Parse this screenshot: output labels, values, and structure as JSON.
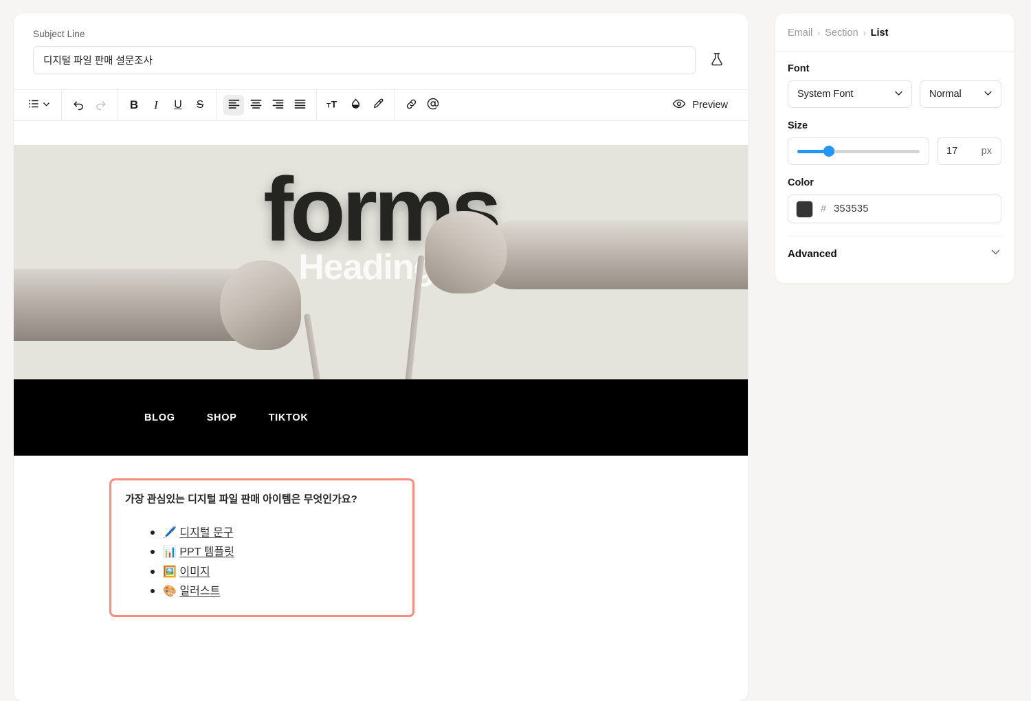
{
  "editor": {
    "subject": {
      "label": "Subject Line",
      "value": "디지털 파일 판매 설문조사",
      "placeholder": "Subject Line",
      "ab_test_icon": "flask-icon"
    },
    "toolbar": {
      "list_icon": "bullet-list-icon",
      "list_chevron_icon": "chevron-down-icon",
      "undo_icon": "undo-icon",
      "redo_icon": "redo-icon",
      "bold_label": "B",
      "italic_label": "I",
      "underline_label": "U",
      "strikethrough_label": "S",
      "align_left_icon": "align-left-icon",
      "align_center_icon": "align-center-icon",
      "align_right_icon": "align-right-icon",
      "align_justify_icon": "align-justify-icon",
      "font_size_label": "TT",
      "text_color_icon": "droplet-icon",
      "highlighter_icon": "highlighter-icon",
      "link_icon": "link-icon",
      "mention_icon": "at-icon",
      "preview_label": "Preview",
      "preview_icon": "eye-icon",
      "active_alignment": "left"
    }
  },
  "email": {
    "hero": {
      "brand_text": "forms",
      "heading_text": "Heading 1",
      "background_color": "#e4e3dc"
    },
    "navbar": {
      "background_color": "#000000",
      "links": [
        {
          "label": "BLOG"
        },
        {
          "label": "SHOP"
        },
        {
          "label": "TIKTOK"
        }
      ]
    },
    "selected_block": {
      "outline_color": "#fb8c7e",
      "question": "가장 관심있는 디지털 파일 판매 아이템은 무엇인가요?",
      "items": [
        {
          "emoji": "🖊️",
          "emoji_name": "pen-emoji",
          "label": "디지털 문구"
        },
        {
          "emoji": "📊",
          "emoji_name": "bar-chart-emoji",
          "label": "PPT 템플릿"
        },
        {
          "emoji": "🖼️",
          "emoji_name": "framed-picture-emoji",
          "label": "이미지"
        },
        {
          "emoji": "🎨",
          "emoji_name": "artist-palette-emoji",
          "label": "일러스트"
        }
      ]
    }
  },
  "properties": {
    "breadcrumb": {
      "level1": "Email",
      "level2": "Section",
      "level3": "List",
      "separator": "›"
    },
    "font": {
      "label": "Font",
      "family_value": "System Font",
      "weight_value": "Normal",
      "chevron_icon": "chevron-down-icon"
    },
    "size": {
      "label": "Size",
      "value": "17",
      "unit": "px",
      "slider_percent": 26,
      "slider_accent": "#2196f3"
    },
    "color": {
      "label": "Color",
      "hash": "#",
      "hex_value": "353535",
      "swatch_color": "#353535"
    },
    "advanced": {
      "label": "Advanced",
      "chevron_icon": "chevron-down-icon"
    }
  }
}
